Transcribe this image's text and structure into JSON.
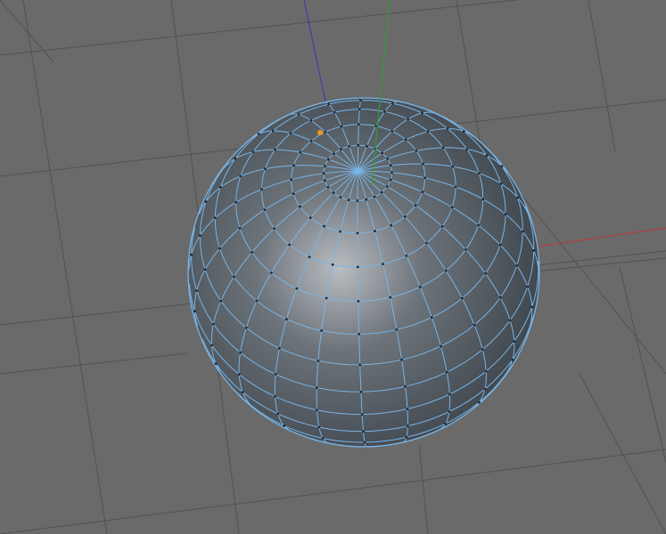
{
  "viewport": {
    "background": "#6a6a6a",
    "grid_color": "#525252"
  },
  "axes": [
    {
      "axis": "x",
      "color": "#c33636"
    },
    {
      "axis": "y",
      "color": "#2fa02f"
    },
    {
      "axis": "z",
      "color": "#3a36b0"
    }
  ],
  "mesh": {
    "object": "sphere",
    "shading": "smooth",
    "base_color": "#3a4148",
    "highlight_color": "#b9bdc2",
    "wire_color": "#78b4e6",
    "vertex_color": "#1e2a36",
    "selected_vertex_color": "#f39a1a",
    "selected_vertex_count": 1
  }
}
